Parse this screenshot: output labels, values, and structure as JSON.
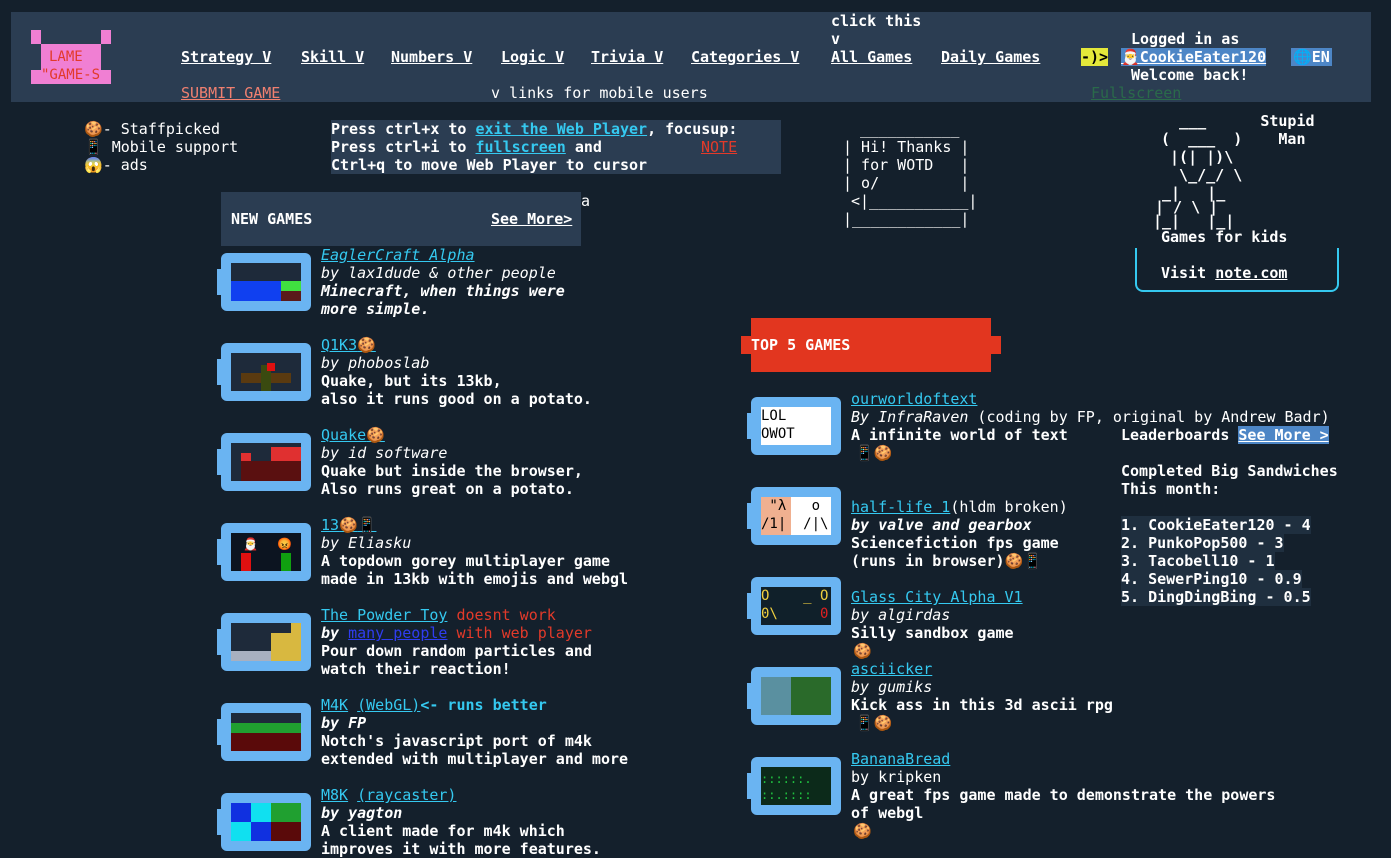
{
  "header": {
    "logo_line1": "LAME",
    "logo_line2": "\"GAME-S",
    "nav": [
      "Strategy V",
      "Skill V",
      "Numbers V",
      "Logic V",
      "Trivia V",
      "Categories V"
    ],
    "click_this": "click this",
    "click_this_v": "v",
    "all_games": "All Games",
    "daily_games": "Daily Games",
    "submit_game": "SUBMIT GAME",
    "mobile_links": "v links for mobile users",
    "logged_in_as": "Logged in as",
    "arrow": "-)>",
    "username": "CookieEater120",
    "lang": "EN",
    "welcome": "Welcome back!",
    "fullscreen_hidden": "Fullscreen"
  },
  "legend": {
    "staffpicked": "- Staffpicked",
    "mobile": " Mobile support",
    "ads": "- ads"
  },
  "controls": {
    "line1_a": "Press ctrl+x to ",
    "line1_link": "exit the Web Player",
    "line1_b": ", focusup:",
    "line2_a": "Press ctrl+i to ",
    "line2_link": "fullscreen",
    "line2_b": " and",
    "line2_note": "NOTE",
    "line3": "Ctrl+q to move Web Player to cursor"
  },
  "wotd": {
    "top": " ___________",
    "l1": "| Hi! Thanks |",
    "l2": "| for WOTD   |",
    "l3": "| o/         |",
    "l4": "<|___________|",
    "l5": "|____________|"
  },
  "ascii_man": {
    "l1": "  ___      Stupid",
    "l2": " _|   |_",
    "l3": "(  ___  )    Man",
    "l4": " |(| |)\\",
    "l5": "  \\_/_/ \\",
    "l6": " _|   |_",
    "l7": "| / \\ |",
    "l8": "|_|   |_|",
    "caption": "Games for kids",
    "visit": "Visit ",
    "visit_link": "note.com"
  },
  "new_games": {
    "title": "NEW GAMES",
    "see_more": "See More>",
    "stray": "a",
    "items": [
      {
        "title": "EaglerCraft Alpha",
        "by": "by lax1dude & other people",
        "d1": "Minecraft, when things were",
        "d2": "more simple."
      },
      {
        "title": "Q1K3",
        "by": "by phoboslab",
        "d1": "Quake, but its 13kb,",
        "d2": "also it runs good on a potato."
      },
      {
        "title": "Quake",
        "by": "by id software",
        "d1": "Quake but inside the browser,",
        "d2": "Also runs great on a potato."
      },
      {
        "title": "13",
        "by": "by Eliasku",
        "d1": "A topdown gorey multiplayer game",
        "d2": "made in 13kb with emojis and webgl"
      },
      {
        "title": "The Powder Toy",
        "title_note": " doesnt work",
        "by_a": "by ",
        "by_link": "many people",
        "by_note": " with web player",
        "d1": "Pour down random particles and",
        "d2": "watch their reaction!"
      },
      {
        "title": "M4K",
        "title_link2": "(WebGL)",
        "title_note": "<- runs better",
        "by": "by FP",
        "d1": "Notch's javascript port of m4k",
        "d2": "extended with multiplayer and more"
      },
      {
        "title": "M8K",
        "title_link2": "(raycaster)",
        "by": "by yagton",
        "d1": "A client made for m4k which",
        "d2": "improves it with more features."
      }
    ]
  },
  "top5": {
    "title": "TOP 5 GAMES",
    "items": [
      {
        "title": "ourworldoftext",
        "by_a": "By InfraRaven",
        "by_b": " (coding by FP, original by Andrew Badr)",
        "d1": "A infinite world of text",
        "thumb_a": "LOL",
        "thumb_b": "OWOT"
      },
      {
        "title": "half-life 1",
        "title_note": "(hldm broken)",
        "by": "by valve and gearbox",
        "d1": "Sciencefiction fps game",
        "d2": "(runs in browser)"
      },
      {
        "title": "Glass City Alpha V1",
        "by": "by algirdas",
        "d1": "Silly sandbox game"
      },
      {
        "title": "asciicker",
        "by": "by gumiks",
        "d1": "Kick ass in this 3d ascii rpg"
      },
      {
        "title": "BananaBread",
        "by": "by kripken",
        "d1": "A great fps game made to demonstrate the powers",
        "d2": "of webgl"
      }
    ]
  },
  "leaderboard": {
    "label": "Leaderboards ",
    "see_more": "See More >",
    "heading1": "Completed Big Sandwiches",
    "heading2": "This month:",
    "rows": [
      "1. CookieEater120 - 4",
      "2. PunkoPop500 - 3",
      "3. Tacobell10 - 1",
      "4. SewerPing10 - 0.9",
      "5. DingDingBing - 0.5"
    ]
  },
  "colors": {
    "background": "#14202c",
    "panel": "#2b3d52",
    "accent_red": "#e2361f",
    "link_cyan": "#35c9f0",
    "thumb": "#6ab4f2",
    "logo_pink": "#f07fd3"
  }
}
